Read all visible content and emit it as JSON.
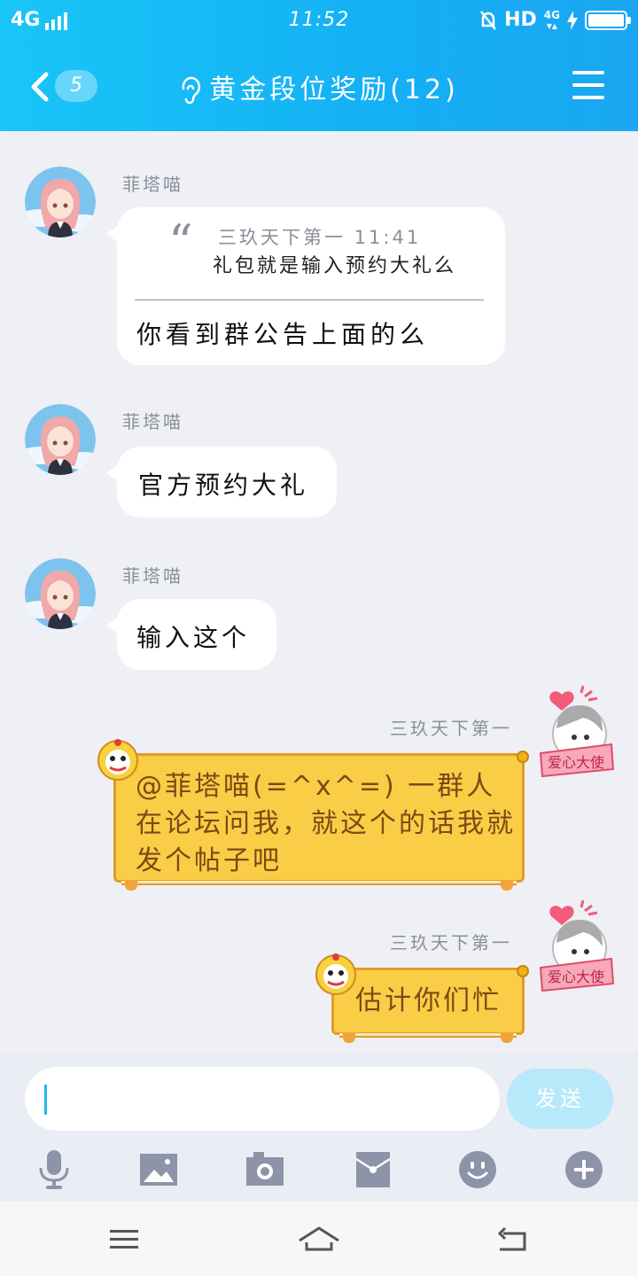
{
  "status_bar": {
    "network": "4G",
    "time": "11:52",
    "hd": "HD",
    "lte": "4G"
  },
  "title_bar": {
    "back_count": "5",
    "title": "黄金段位奖励(12)"
  },
  "messages": [
    {
      "sender": "菲塔喵",
      "quote": {
        "author_time": "三玖天下第一  11:41",
        "text": "礼包就是输入预约大礼么"
      },
      "text": "你看到群公告上面的么"
    },
    {
      "sender": "菲塔喵",
      "text": "官方预约大礼"
    },
    {
      "sender": "菲塔喵",
      "text": "输入这个"
    },
    {
      "sender": "三玖天下第一",
      "text": "@菲塔喵(=^x^=) 一群人在论坛问我，就这个的话我就发个帖子吧"
    },
    {
      "sender": "三玖天下第一",
      "text": "估计你们忙"
    }
  ],
  "input": {
    "value": "",
    "send_label": "发送"
  },
  "colors": {
    "header": "#19c5f7",
    "scroll_bubble": "#f9cd46",
    "send_button": "#b8e9fb"
  }
}
